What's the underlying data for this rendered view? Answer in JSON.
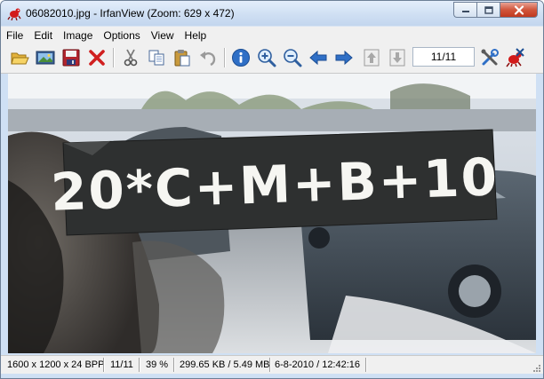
{
  "window": {
    "title": "06082010.jpg - IrfanView (Zoom: 629 x 472)"
  },
  "menu": [
    "File",
    "Edit",
    "Image",
    "Options",
    "View",
    "Help"
  ],
  "toolbar": {
    "page_indicator": "11/11",
    "buttons": [
      "open-icon",
      "slideshow-icon",
      "save-icon",
      "delete-icon",
      "cut-icon",
      "copy-icon",
      "paste-icon",
      "undo-icon",
      "info-icon",
      "zoom-in-icon",
      "zoom-out-icon",
      "previous-icon",
      "next-icon",
      "first-page-icon",
      "last-page-icon",
      "properties-icon",
      "exit-icon"
    ]
  },
  "image": {
    "sign_text": "20*C+M+B+10"
  },
  "status": {
    "dimensions": "1600 x 1200 x 24 BPP",
    "page": "11/11",
    "zoom": "39 %",
    "filesize": "299.65 KB / 5.49 MB",
    "datetime": "6-8-2010 / 12:42:16"
  },
  "colors": {
    "titlebar": "#cfdff3",
    "toolbar_bg": "#f0f0f0",
    "sign_bg": "#2e3030",
    "accent_blue": "#2f6fc6"
  }
}
